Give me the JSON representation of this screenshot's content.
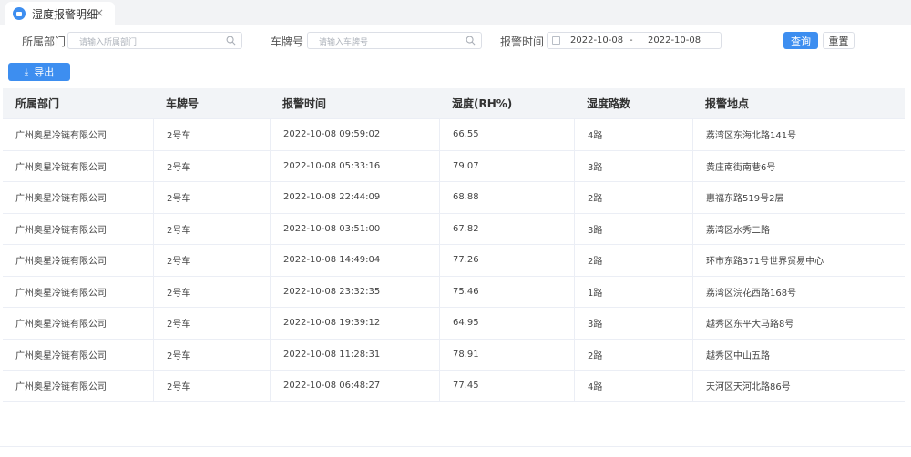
{
  "tab": {
    "title": "湿度报警明细",
    "close": "×"
  },
  "filters": {
    "dept_label": "所属部门",
    "dept_placeholder": "请输入所属部门",
    "plate_label": "车牌号",
    "plate_placeholder": "请输入车牌号",
    "time_label": "报警时间",
    "start_date": "2022-10-08",
    "date_sep": "-",
    "end_date": "2022-10-08"
  },
  "buttons": {
    "query": "查询",
    "reset": "重置",
    "export": "导出"
  },
  "table": {
    "headers": [
      "所属部门",
      "车牌号",
      "报警时间",
      "湿度(RH%)",
      "湿度路数",
      "报警地点"
    ],
    "rows": [
      [
        "广州奥星冷链有限公司",
        "2号车",
        "2022-10-08 09:59:02",
        "66.55",
        "4路",
        "荔湾区东海北路141号"
      ],
      [
        "广州奥星冷链有限公司",
        "2号车",
        "2022-10-08 05:33:16",
        "79.07",
        "3路",
        "黄庄南街南巷6号"
      ],
      [
        "广州奥星冷链有限公司",
        "2号车",
        "2022-10-08 22:44:09",
        "68.88",
        "2路",
        "惠福东路519号2层"
      ],
      [
        "广州奥星冷链有限公司",
        "2号车",
        "2022-10-08 03:51:00",
        "67.82",
        "3路",
        "荔湾区水秀二路"
      ],
      [
        "广州奥星冷链有限公司",
        "2号车",
        "2022-10-08 14:49:04",
        "77.26",
        "2路",
        "环市东路371号世界贸易中心"
      ],
      [
        "广州奥星冷链有限公司",
        "2号车",
        "2022-10-08 23:32:35",
        "75.46",
        "1路",
        "荔湾区浣花西路168号"
      ],
      [
        "广州奥星冷链有限公司",
        "2号车",
        "2022-10-08 19:39:12",
        "64.95",
        "3路",
        "越秀区东平大马路8号"
      ],
      [
        "广州奥星冷链有限公司",
        "2号车",
        "2022-10-08 11:28:31",
        "78.91",
        "2路",
        "越秀区中山五路"
      ],
      [
        "广州奥星冷链有限公司",
        "2号车",
        "2022-10-08 06:48:27",
        "77.45",
        "4路",
        "天河区天河北路86号"
      ]
    ]
  },
  "colors": {
    "primary": "#3d8ef0",
    "header_bg": "#f2f4f7",
    "border": "#ebeef5"
  }
}
